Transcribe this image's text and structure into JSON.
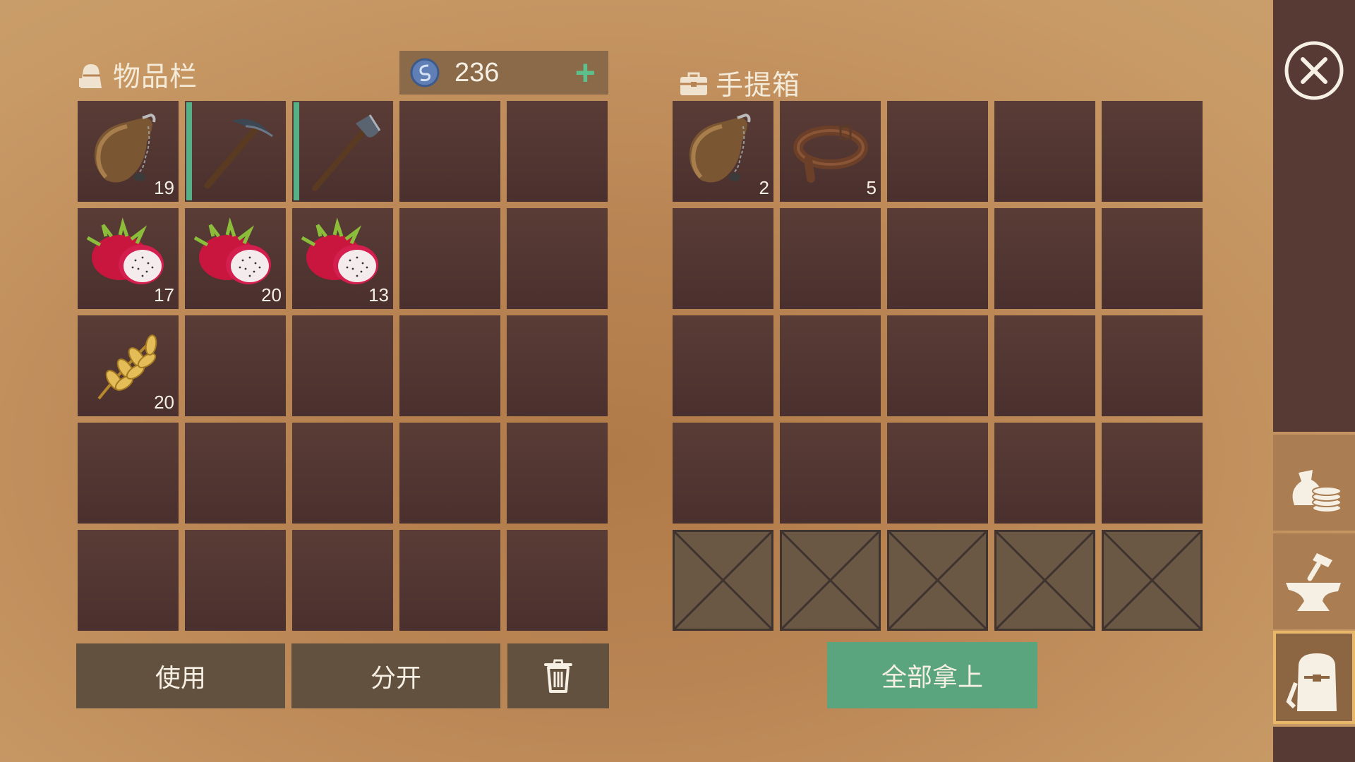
{
  "inventory": {
    "title": "物品栏",
    "currency": {
      "amount": "236",
      "add_label": "+"
    },
    "slots": [
      {
        "item": "waterskin-icon",
        "count": "19"
      },
      {
        "item": "pickaxe-icon",
        "durability": 1.0
      },
      {
        "item": "hatchet-icon",
        "durability": 1.0
      },
      {},
      {},
      {
        "item": "dragon-fruit-icon",
        "count": "17"
      },
      {
        "item": "dragon-fruit-icon",
        "count": "20"
      },
      {
        "item": "dragon-fruit-icon",
        "count": "13"
      },
      {},
      {},
      {
        "item": "wheat-icon",
        "count": "20"
      },
      {},
      {},
      {},
      {},
      {},
      {},
      {},
      {},
      {},
      {},
      {},
      {},
      {},
      {}
    ],
    "buttons": {
      "use": "使用",
      "split": "分开",
      "trash_icon": "trash-icon"
    }
  },
  "container": {
    "title": "手提箱",
    "slots": [
      {
        "item": "waterskin-icon",
        "count": "2"
      },
      {
        "item": "leather-belt-icon",
        "count": "5"
      },
      {},
      {},
      {},
      {},
      {},
      {},
      {},
      {},
      {},
      {},
      {},
      {},
      {},
      {},
      {},
      {},
      {},
      {},
      {
        "locked": true
      },
      {
        "locked": true
      },
      {
        "locked": true
      },
      {
        "locked": true
      },
      {
        "locked": true
      }
    ],
    "take_all": "全部拿上"
  },
  "sidebar": {
    "close_icon": "close-icon",
    "tabs": [
      "trade-icon",
      "crafting-anvil-icon",
      "backpack-icon"
    ],
    "active_tab": 2
  },
  "colors": {
    "slot": "#4e3331",
    "accent_green": "#5aa47e",
    "durability": "#55b088",
    "sidebar": "#583a35"
  }
}
